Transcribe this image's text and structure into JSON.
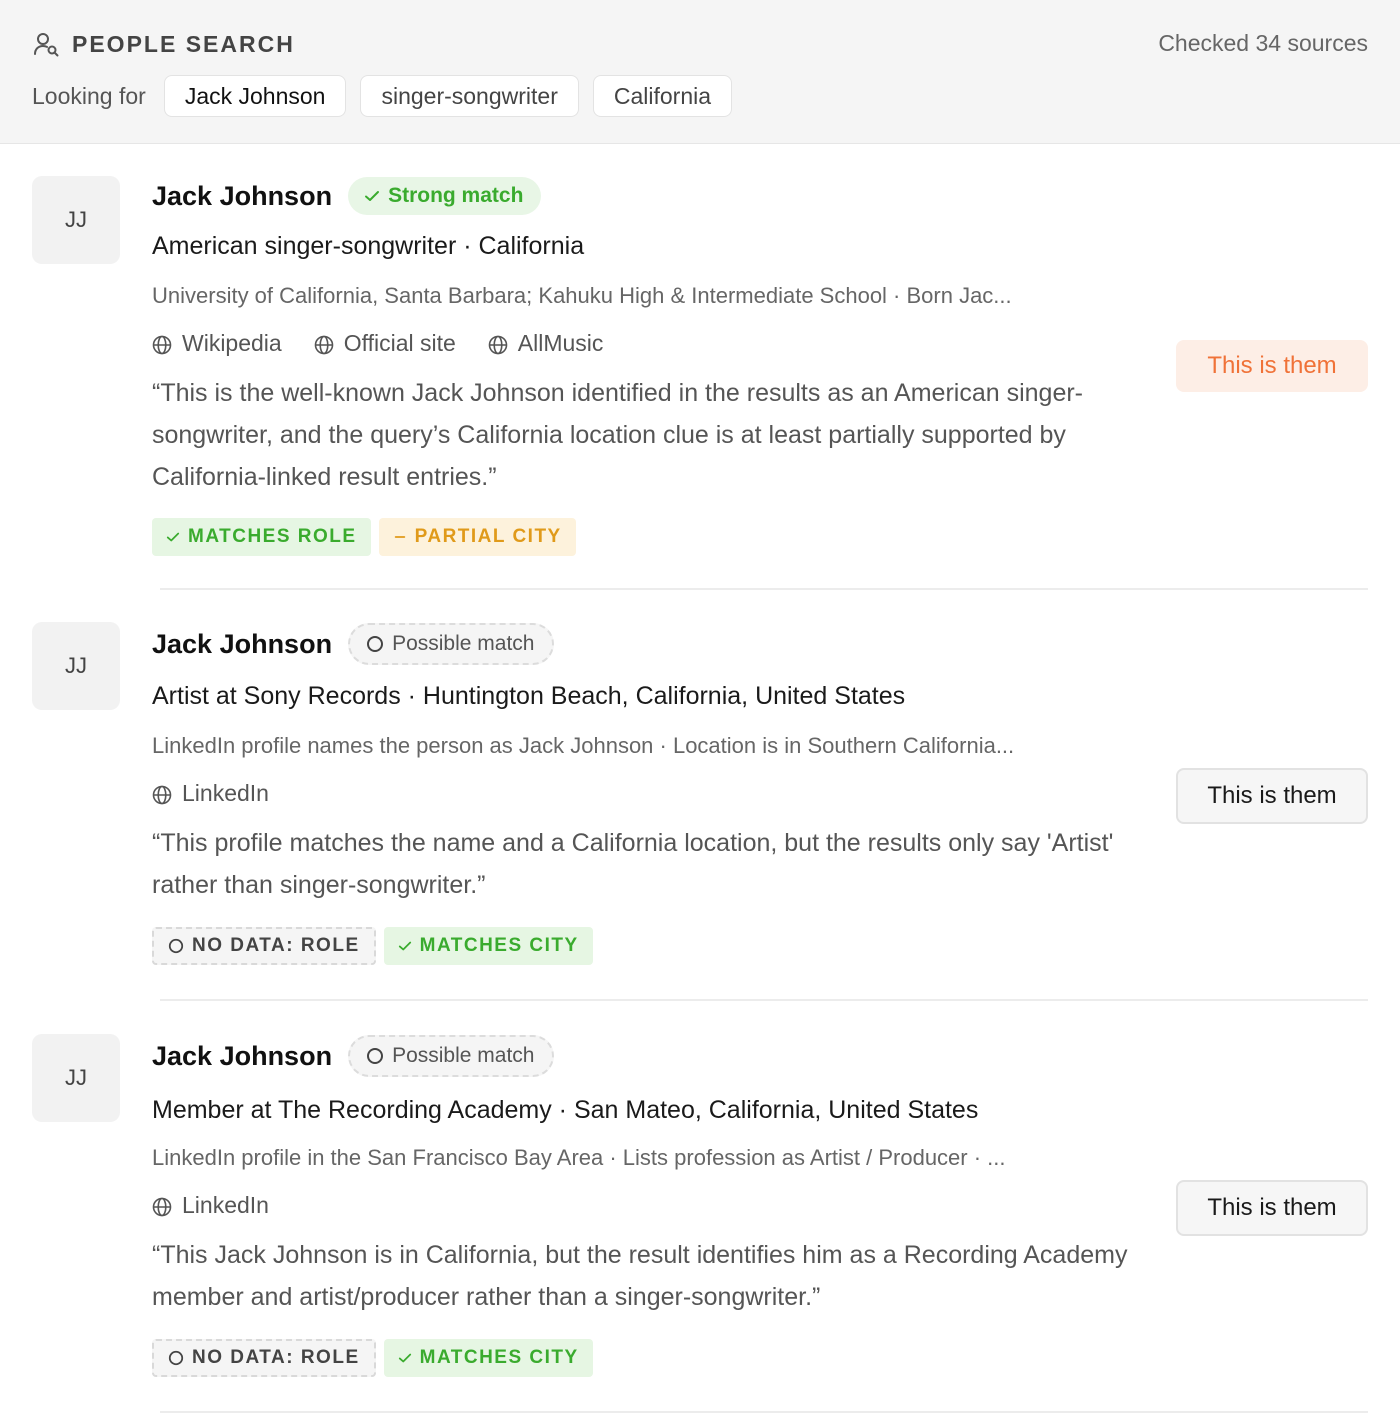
{
  "header": {
    "title": "PEOPLE SEARCH",
    "checked_sources": "Checked 34 sources",
    "looking_for_label": "Looking for",
    "chips": [
      "Jack Johnson",
      "singer-songwriter",
      "California"
    ]
  },
  "results": [
    {
      "initials": "JJ",
      "name": "Jack Johnson",
      "match_label": "Strong match",
      "match_type": "strong",
      "headline": "American singer-songwriter · California",
      "subline": "University of California, Santa Barbara; Kahuku High & Intermediate School · Born Jac...",
      "sources": [
        "Wikipedia",
        "Official site",
        "AllMusic"
      ],
      "quote": "“This is the well-known Jack Johnson identified in the results as an American singer-songwriter, and the query’s California location clue is at least partially supported by California-linked result entries.”",
      "tags": [
        {
          "label": "MATCHES ROLE",
          "kind": "green"
        },
        {
          "label": "PARTIAL CITY",
          "kind": "amber"
        }
      ],
      "button_label": "This is them"
    },
    {
      "initials": "JJ",
      "name": "Jack Johnson",
      "match_label": "Possible match",
      "match_type": "possible",
      "headline": "Artist at Sony Records · Huntington Beach, California, United States",
      "subline": "LinkedIn profile names the person as Jack Johnson · Location is in Southern California...",
      "sources": [
        "LinkedIn"
      ],
      "quote": "“This profile matches the name and a California location, but the results only say 'Artist' rather than singer-songwriter.”",
      "tags": [
        {
          "label": "NO DATA: ROLE",
          "kind": "gray"
        },
        {
          "label": "MATCHES CITY",
          "kind": "green"
        }
      ],
      "button_label": "This is them"
    },
    {
      "initials": "JJ",
      "name": "Jack Johnson",
      "match_label": "Possible match",
      "match_type": "possible",
      "headline": "Member at The Recording Academy · San Mateo, California, United States",
      "subline": "LinkedIn profile in the San Francisco Bay Area · Lists profession as Artist / Producer · ...",
      "sources": [
        "LinkedIn"
      ],
      "quote": "“This Jack Johnson is in California, but the result identifies him as a Recording Academy member and artist/producer rather than a singer-songwriter.”",
      "tags": [
        {
          "label": "NO DATA: ROLE",
          "kind": "gray"
        },
        {
          "label": "MATCHES CITY",
          "kind": "green"
        }
      ],
      "button_label": "This is them"
    }
  ],
  "colors": {
    "accent_orange": "#f07238",
    "match_green": "#3aab2e",
    "partial_amber": "#e09a1a"
  },
  "icons": {
    "header": "person-search-icon",
    "source": "globe-icon",
    "strong": "check-icon",
    "possible": "circle-icon",
    "partial": "dash-icon"
  }
}
